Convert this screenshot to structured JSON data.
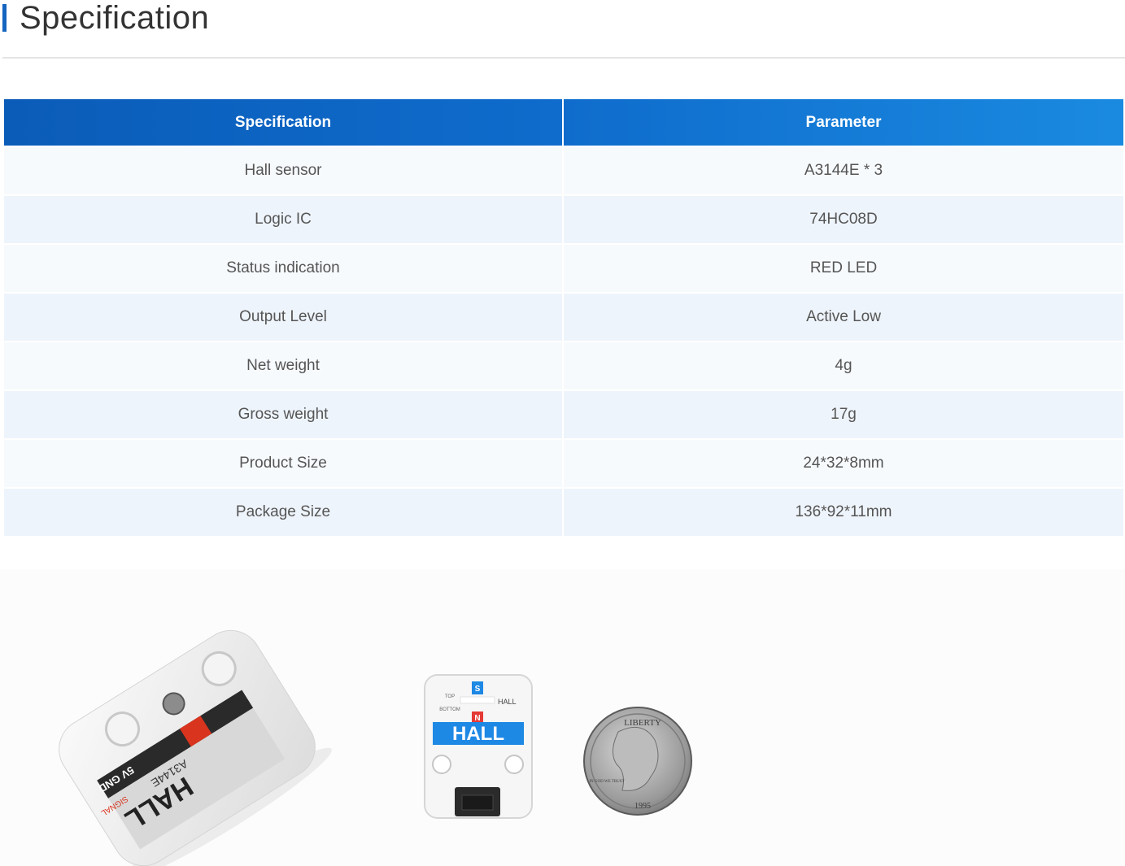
{
  "section": {
    "title": "Specification"
  },
  "table": {
    "headers": [
      "Specification",
      "Parameter"
    ],
    "rows": [
      [
        "Hall sensor",
        "A3144E * 3"
      ],
      [
        "Logic IC",
        "74HC08D"
      ],
      [
        "Status indication",
        "RED LED"
      ],
      [
        "Output Level",
        "Active Low"
      ],
      [
        "Net weight",
        "4g"
      ],
      [
        "Gross weight",
        "17g"
      ],
      [
        "Product Size",
        "24*32*8mm"
      ],
      [
        "Package Size",
        "136*92*11mm"
      ]
    ]
  },
  "photos": {
    "module_angled": {
      "label_hall": "HALL",
      "label_part": "A3144E",
      "label_pins": "5V GND",
      "label_signal": "SIGNAL"
    },
    "module_front": {
      "label_hall": "HALL",
      "label_small": "HALL",
      "label_top": "TOP",
      "label_bottom": "BOTTOM",
      "label_s": "S",
      "label_n": "N"
    },
    "coin": {
      "label_top": "LIBERTY",
      "label_bottom": "1995",
      "label_left": "IN GOD WE TRUST"
    }
  },
  "colors": {
    "accent": "#1565c0",
    "header_start": "#0b5cb8",
    "header_end": "#1a8ae0",
    "row_even": "#eef4fb",
    "row_odd": "#f7fafd"
  }
}
